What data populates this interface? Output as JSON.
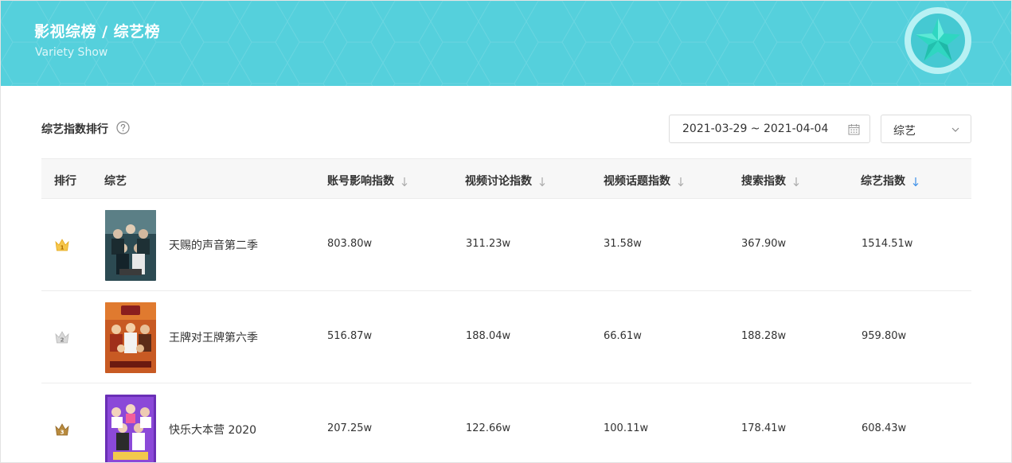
{
  "header": {
    "title": "影视综榜 / 综艺榜",
    "subtitle": "Variety Show",
    "badge_icon": "star-icon",
    "background_color": "#55d0dc"
  },
  "section": {
    "title": "综艺指数排行",
    "help_icon": "question-circle-icon"
  },
  "filters": {
    "date_range": "2021-03-29 ~ 2021-04-04",
    "category": "综艺"
  },
  "table": {
    "columns": [
      "排行",
      "综艺",
      "账号影响指数",
      "视频讨论指数",
      "视频话题指数",
      "搜索指数",
      "综艺指数"
    ],
    "active_sort_column": "综艺指数",
    "active_sort_color": "#3b8fe8",
    "rows": [
      {
        "rank_icon": "gold-crown-1-icon",
        "name": "天赐的声音第二季",
        "account_influence": "803.80w",
        "video_discussion": "311.23w",
        "video_topic": "31.58w",
        "search": "367.90w",
        "variety_index": "1514.51w"
      },
      {
        "rank_icon": "silver-crown-2-icon",
        "name": "王牌对王牌第六季",
        "account_influence": "516.87w",
        "video_discussion": "188.04w",
        "video_topic": "66.61w",
        "search": "188.28w",
        "variety_index": "959.80w"
      },
      {
        "rank_icon": "bronze-crown-3-icon",
        "name": "快乐大本营 2020",
        "account_influence": "207.25w",
        "video_discussion": "122.66w",
        "video_topic": "100.11w",
        "search": "178.41w",
        "variety_index": "608.43w"
      }
    ]
  }
}
